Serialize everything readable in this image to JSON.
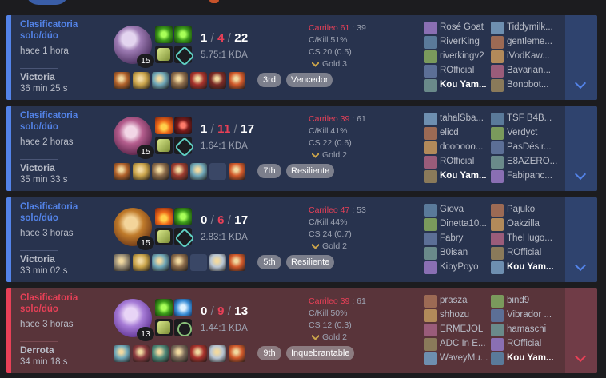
{
  "colors": {
    "win_accent": "#5383e8",
    "loss_accent": "#e84057",
    "win_bg": "#28334e",
    "loss_bg": "#59343a"
  },
  "matches": [
    {
      "queue": "Clasificatoria solo/dúo",
      "time_ago": "hace 1 hora",
      "result": "Victoria",
      "duration": "36 min 25 s",
      "champion_level": "15",
      "kills": "1",
      "deaths": "4",
      "assists": "22",
      "kda_ratio": "5.75:1 KDA",
      "placement": "3rd",
      "badge": "Vencedor",
      "kill_participation_label": "Carrileo 61",
      "kill_participation_sep": ": 39",
      "ckill": "C/Kill 51%",
      "cs": "CS 20 (0.5)",
      "rank": "Gold 3",
      "spells": [
        "smite-icon",
        "smite-icon"
      ],
      "players": [
        "Rosé Goat",
        "Tiddymilk...",
        "RiverKing",
        "gentleme...",
        "riverkingv2",
        "iVodKaw...",
        "ROfficial",
        "Bavarian...",
        "Kou Yam...",
        "Bonobot..."
      ]
    },
    {
      "queue": "Clasificatoria solo/dúo",
      "time_ago": "hace 2 horas",
      "result": "Victoria",
      "duration": "35 min 33 s",
      "champion_level": "15",
      "kills": "1",
      "deaths": "11",
      "assists": "17",
      "kda_ratio": "1.64:1 KDA",
      "placement": "7th",
      "badge": "Resiliente",
      "kill_participation_label": "Carrileo 39",
      "kill_participation_sep": ": 61",
      "ckill": "C/Kill 41%",
      "cs": "CS 22 (0.6)",
      "rank": "Gold 2",
      "spells": [
        "ignite-icon",
        "exhaust-icon"
      ],
      "players": [
        "tahalSba...",
        "TSF B4B...",
        "elicd",
        "Verdyct",
        "doooooo...",
        "PasDésir...",
        "ROfficial",
        "E8AZERO...",
        "Kou Yam...",
        "Fabipanc..."
      ]
    },
    {
      "queue": "Clasificatoria solo/dúo",
      "time_ago": "hace 3 horas",
      "result": "Victoria",
      "duration": "33 min 02 s",
      "champion_level": "15",
      "kills": "0",
      "deaths": "6",
      "assists": "17",
      "kda_ratio": "2.83:1 KDA",
      "placement": "5th",
      "badge": "Resiliente",
      "kill_participation_label": "Carrileo 47",
      "kill_participation_sep": ": 53",
      "ckill": "C/Kill 44%",
      "cs": "CS 24 (0.7)",
      "rank": "Gold 2",
      "spells": [
        "ignite-icon",
        "smite-icon"
      ],
      "players": [
        "Giova",
        "Pajuko",
        "Dinetta10...",
        "Oakzilla",
        "Fabry",
        "TheHugo...",
        "B0isan",
        "ROfficial",
        "KibyPoyo",
        "Kou Yam..."
      ]
    },
    {
      "queue": "Clasificatoria solo/dúo",
      "time_ago": "hace 3 horas",
      "result": "Derrota",
      "duration": "34 min 18 s",
      "champion_level": "13",
      "kills": "0",
      "deaths": "9",
      "assists": "13",
      "kda_ratio": "1.44:1 KDA",
      "placement": "9th",
      "badge": "Inquebrantable",
      "kill_participation_label": "Carrileo 39",
      "kill_participation_sep": ": 61",
      "ckill": "C/Kill 50%",
      "cs": "CS 12 (0.3)",
      "rank": "Gold 2",
      "spells": [
        "smite-icon",
        "flash-icon"
      ],
      "players": [
        "prasza",
        "bind9",
        "shhozu",
        "Vibrador ...",
        "ERMEJOL",
        "hamaschi",
        "ADC In E...",
        "ROfficial",
        "WaveyMu...",
        "Kou Yam..."
      ]
    }
  ]
}
